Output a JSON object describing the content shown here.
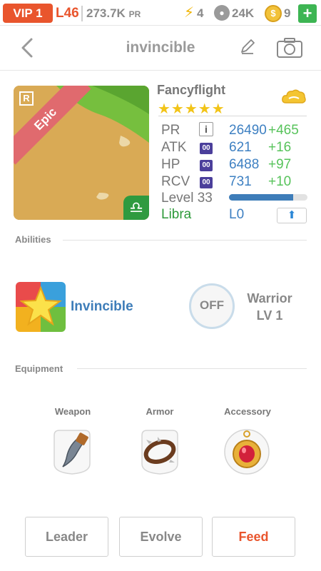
{
  "statusbar": {
    "vip": "VIP 1",
    "level": "L46",
    "pr": "273.7K",
    "pr_unit": "PR",
    "energy": "4",
    "food": "24K",
    "gold": "9",
    "plus": "+"
  },
  "header": {
    "title": "invincible"
  },
  "pet": {
    "rarity_letter": "R",
    "rarity": "Epic",
    "name": "Fancyflight",
    "stars": "★★★★★",
    "star_count": 5,
    "stats": [
      {
        "label": "PR",
        "value": "26490",
        "bonus": "+465"
      },
      {
        "label": "ATK",
        "badge": "00",
        "value": "621",
        "bonus": "+16"
      },
      {
        "label": "HP",
        "badge": "00",
        "value": "6488",
        "bonus": "+97"
      },
      {
        "label": "RCV",
        "badge": "00",
        "value": "731",
        "bonus": "+10"
      }
    ],
    "level_label": "Level 33",
    "level_progress": 0.82,
    "sign": "Libra",
    "sign_level": "L0",
    "info_icon": "i"
  },
  "abilities": {
    "heading": "Abilities",
    "ability_name": "Invincible",
    "off_label": "OFF",
    "warrior_title": "Warrior",
    "warrior_level": "LV 1"
  },
  "equipment": {
    "heading": "Equipment",
    "slots": [
      {
        "label": "Weapon",
        "icon": "claw-icon"
      },
      {
        "label": "Armor",
        "icon": "spiked-collar-icon"
      },
      {
        "label": "Accessory",
        "icon": "ruby-amulet-icon"
      }
    ]
  },
  "actions": {
    "leader": "Leader",
    "evolve": "Evolve",
    "feed": "Feed"
  },
  "colors": {
    "accent": "#e9552d",
    "blue": "#3e80c2",
    "green": "#57c35b",
    "libra_green": "#2d9a3a"
  }
}
